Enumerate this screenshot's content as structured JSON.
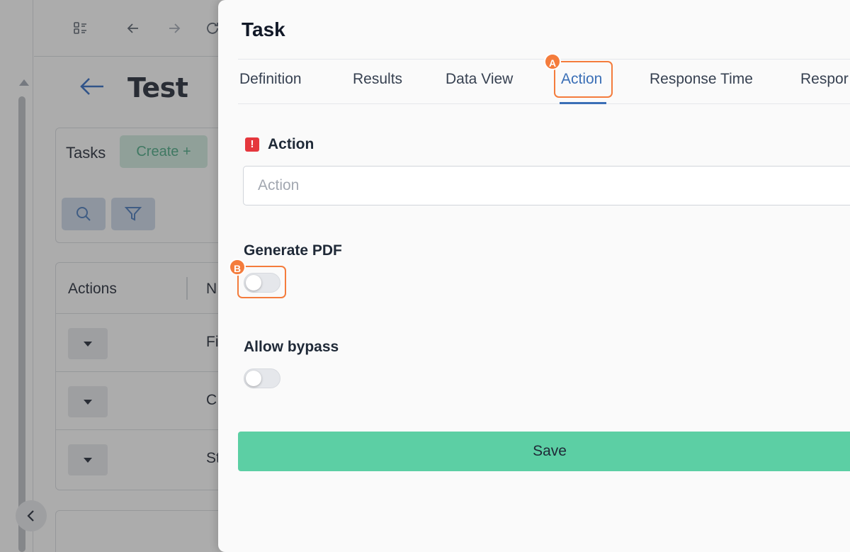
{
  "background": {
    "title": "Test",
    "tasks_label": "Tasks",
    "create_label": "Create +",
    "table": {
      "header_actions": "Actions",
      "header_name_partial": "N",
      "rows": [
        "Fi",
        "C",
        "St"
      ]
    }
  },
  "drawer": {
    "title": "Task",
    "tabs": [
      "Definition",
      "Results",
      "Data View",
      "Action",
      "Response Time",
      "Respor"
    ],
    "active_tab": "Action",
    "action_field": {
      "label": "Action",
      "required_badge": "!",
      "value": "",
      "placeholder": "Action"
    },
    "generate_pdf": {
      "label": "Generate PDF",
      "checked": false
    },
    "allow_bypass": {
      "label": "Allow bypass",
      "checked": false
    },
    "save_label": "Save"
  },
  "annotations": {
    "marker_a": "A",
    "marker_b": "B",
    "color": "#f47c3c"
  },
  "colors": {
    "accent_blue": "#3b6fb6",
    "save_green": "#5ccfa4",
    "required_red": "#e5373d"
  }
}
